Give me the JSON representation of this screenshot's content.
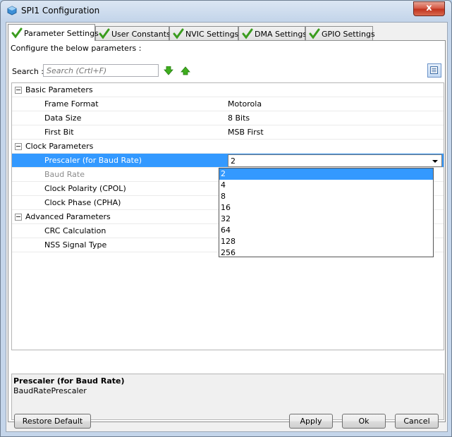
{
  "window": {
    "title": "SPI1 Configuration",
    "close_label": "x"
  },
  "tabs": [
    {
      "label": "Parameter Settings"
    },
    {
      "label": "User Constants"
    },
    {
      "label": "NVIC Settings"
    },
    {
      "label": "DMA Settings"
    },
    {
      "label": "GPIO Settings"
    }
  ],
  "panel": {
    "configure_text": "Configure the below parameters :",
    "search_label": "Search :",
    "search_placeholder": "Search (Crtl+F)"
  },
  "tree": {
    "groups": [
      {
        "name": "Basic Parameters",
        "params": [
          {
            "name": "Frame Format",
            "value": "Motorola"
          },
          {
            "name": "Data Size",
            "value": "8 Bits"
          },
          {
            "name": "First Bit",
            "value": "MSB First"
          }
        ]
      },
      {
        "name": "Clock Parameters",
        "params": [
          {
            "name": "Prescaler (for Baud Rate)",
            "value": "2"
          },
          {
            "name": "Baud Rate",
            "value": ""
          },
          {
            "name": "Clock Polarity (CPOL)",
            "value": ""
          },
          {
            "name": "Clock Phase (CPHA)",
            "value": ""
          }
        ]
      },
      {
        "name": "Advanced Parameters",
        "params": [
          {
            "name": "CRC Calculation",
            "value": ""
          },
          {
            "name": "NSS Signal Type",
            "value": ""
          }
        ]
      }
    ]
  },
  "dropdown": {
    "options": [
      "2",
      "4",
      "8",
      "16",
      "32",
      "64",
      "128",
      "256"
    ],
    "highlighted": "2"
  },
  "description": {
    "title": "Prescaler (for Baud Rate)",
    "text": "BaudRatePrescaler"
  },
  "buttons": {
    "restore": "Restore Default",
    "apply": "Apply",
    "ok": "Ok",
    "cancel": "Cancel"
  },
  "colors": {
    "selection": "#3399ff",
    "check": "#3a9c1e",
    "arrow": "#3fae1e"
  }
}
